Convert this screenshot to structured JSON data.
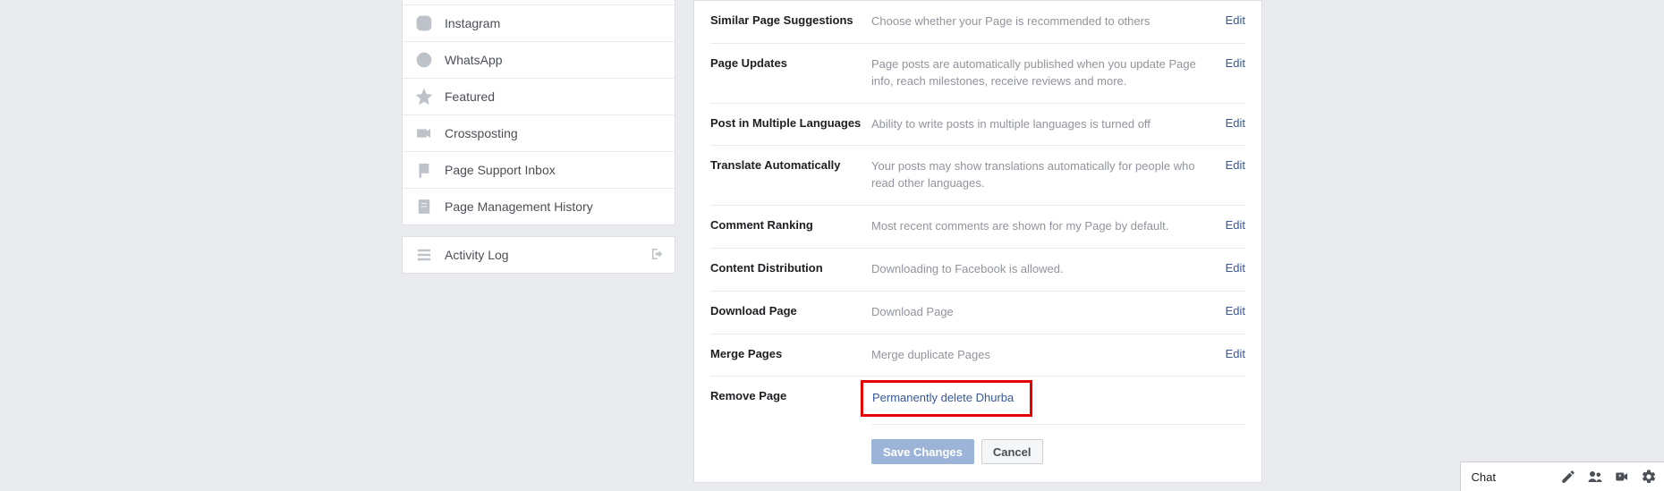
{
  "sidebar": {
    "group1": [
      {
        "label": "Instagram",
        "icon": "instagram"
      },
      {
        "label": "WhatsApp",
        "icon": "whatsapp"
      },
      {
        "label": "Featured",
        "icon": "star"
      },
      {
        "label": "Crossposting",
        "icon": "camera"
      },
      {
        "label": "Page Support Inbox",
        "icon": "flag"
      },
      {
        "label": "Page Management History",
        "icon": "doc"
      }
    ],
    "group2": [
      {
        "label": "Activity Log",
        "icon": "list",
        "trailing": "exit"
      }
    ]
  },
  "settings": [
    {
      "key": "similar",
      "label": "Similar Page Suggestions",
      "desc": "Choose whether your Page is recommended to others",
      "edit": "Edit"
    },
    {
      "key": "updates",
      "label": "Page Updates",
      "desc": "Page posts are automatically published when you update Page info, reach milestones, receive reviews and more.",
      "edit": "Edit"
    },
    {
      "key": "multilang",
      "label": "Post in Multiple Languages",
      "desc": "Ability to write posts in multiple languages is turned off",
      "edit": "Edit"
    },
    {
      "key": "translate",
      "label": "Translate Automatically",
      "desc": "Your posts may show translations automatically for people who read other languages.",
      "edit": "Edit"
    },
    {
      "key": "ranking",
      "label": "Comment Ranking",
      "desc": "Most recent comments are shown for my Page by default.",
      "edit": "Edit"
    },
    {
      "key": "content",
      "label": "Content Distribution",
      "desc": "Downloading to Facebook is allowed.",
      "edit": "Edit"
    },
    {
      "key": "download",
      "label": "Download Page",
      "desc": "Download Page",
      "edit": "Edit"
    },
    {
      "key": "merge",
      "label": "Merge Pages",
      "desc": "Merge duplicate Pages",
      "edit": "Edit"
    }
  ],
  "removePage": {
    "label": "Remove Page",
    "link": "Permanently delete Dhurba"
  },
  "buttons": {
    "save": "Save Changes",
    "cancel": "Cancel"
  },
  "chat": {
    "label": "Chat"
  }
}
